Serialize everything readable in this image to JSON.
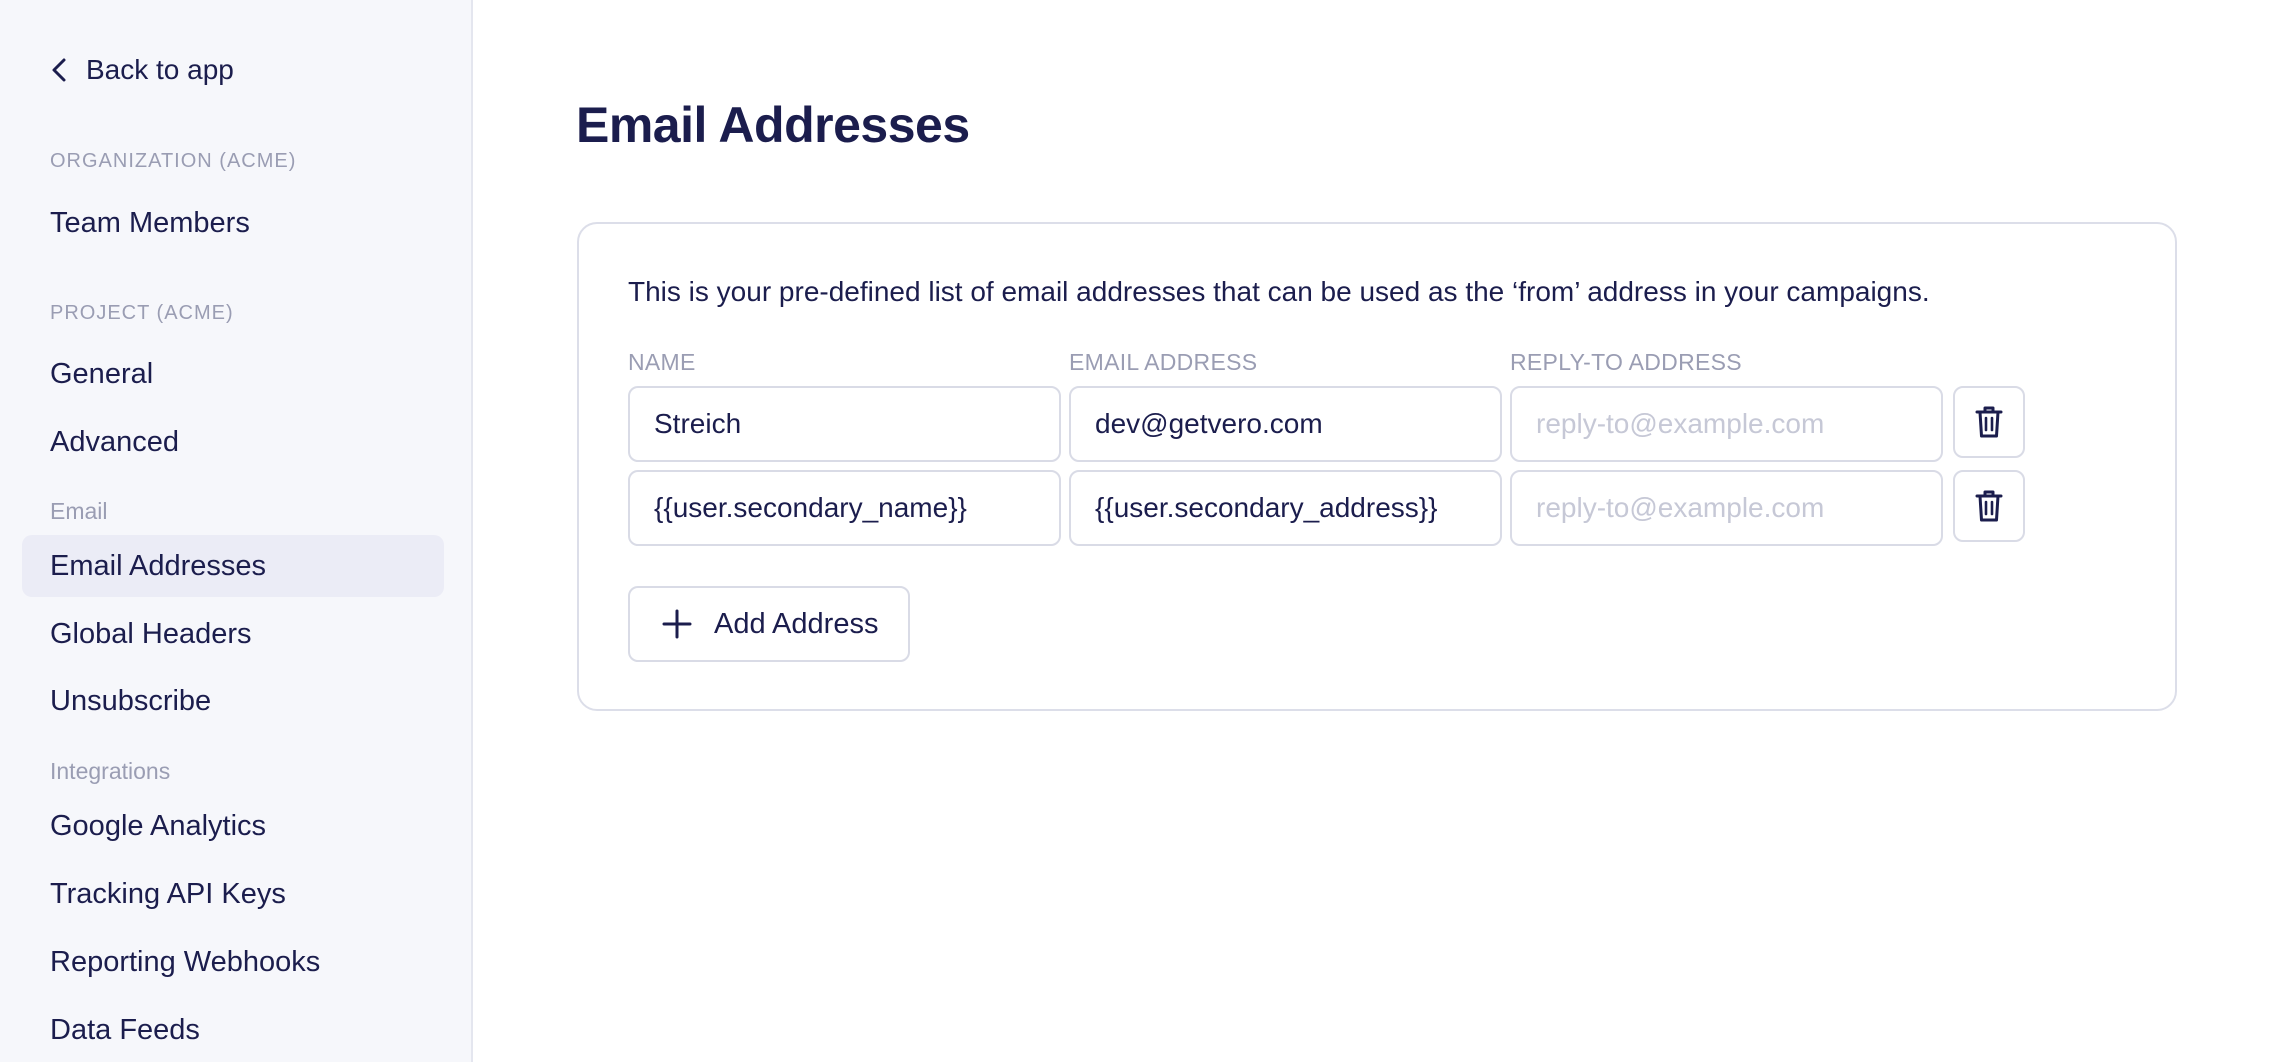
{
  "sidebar": {
    "back_label": "Back to app",
    "sections": {
      "organization": "ORGANIZATION (ACME)",
      "project": "PROJECT (ACME)",
      "email": "Email",
      "integrations": "Integrations"
    },
    "items": {
      "team_members": "Team Members",
      "general": "General",
      "advanced": "Advanced",
      "email_addresses": "Email Addresses",
      "global_headers": "Global Headers",
      "unsubscribe": "Unsubscribe",
      "google_analytics": "Google Analytics",
      "tracking_api_keys": "Tracking API Keys",
      "reporting_webhooks": "Reporting Webhooks",
      "data_feeds": "Data Feeds"
    },
    "active_item": "Email Addresses"
  },
  "main": {
    "title": "Email Addresses",
    "description": "This is your pre-defined list of email addresses that can be used as the ‘from’ address in your campaigns.",
    "columns": {
      "name": "NAME",
      "email": "EMAIL ADDRESS",
      "reply_to": "REPLY-TO ADDRESS"
    },
    "rows": [
      {
        "name": "Streich",
        "email": "dev@getvero.com",
        "reply_to": "",
        "reply_to_placeholder": "reply-to@example.com"
      },
      {
        "name": "{{user.secondary_name}}",
        "email": "{{user.secondary_address}}",
        "reply_to": "",
        "reply_to_placeholder": "reply-to@example.com"
      }
    ],
    "add_button_label": "Add Address"
  },
  "colors": {
    "text_primary": "#1b1d4d",
    "text_muted": "#9a9db3",
    "sidebar_bg": "#f6f7fb",
    "active_item_bg": "#ebecf6",
    "border": "#d9dbe6"
  },
  "icons": {
    "back": "chevron-left-icon",
    "delete": "trash-icon",
    "add": "plus-icon"
  }
}
